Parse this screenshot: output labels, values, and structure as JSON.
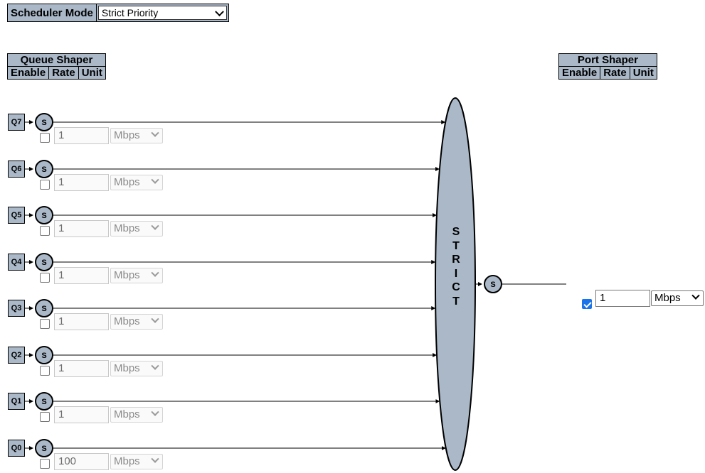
{
  "scheduler": {
    "label": "Scheduler Mode",
    "selected": "Strict Priority"
  },
  "queue_shaper": {
    "title": "Queue Shaper",
    "columns": [
      "Enable",
      "Rate",
      "Unit"
    ]
  },
  "port_shaper": {
    "title": "Port Shaper",
    "columns": [
      "Enable",
      "Rate",
      "Unit"
    ],
    "enabled": true,
    "rate": "1",
    "unit": "Mbps"
  },
  "scheduler_node": {
    "letters": [
      "S",
      "T",
      "R",
      "I",
      "C",
      "T"
    ],
    "output_shaper_symbol": "S"
  },
  "queues": [
    {
      "label": "Q7",
      "shaper_symbol": "S",
      "enabled": false,
      "rate": "1",
      "unit": "Mbps"
    },
    {
      "label": "Q6",
      "shaper_symbol": "S",
      "enabled": false,
      "rate": "1",
      "unit": "Mbps"
    },
    {
      "label": "Q5",
      "shaper_symbol": "S",
      "enabled": false,
      "rate": "1",
      "unit": "Mbps"
    },
    {
      "label": "Q4",
      "shaper_symbol": "S",
      "enabled": false,
      "rate": "1",
      "unit": "Mbps"
    },
    {
      "label": "Q3",
      "shaper_symbol": "S",
      "enabled": false,
      "rate": "1",
      "unit": "Mbps"
    },
    {
      "label": "Q2",
      "shaper_symbol": "S",
      "enabled": false,
      "rate": "1",
      "unit": "Mbps"
    },
    {
      "label": "Q1",
      "shaper_symbol": "S",
      "enabled": false,
      "rate": "1",
      "unit": "Mbps"
    },
    {
      "label": "Q0",
      "shaper_symbol": "S",
      "enabled": false,
      "rate": "100",
      "unit": "Mbps"
    }
  ]
}
